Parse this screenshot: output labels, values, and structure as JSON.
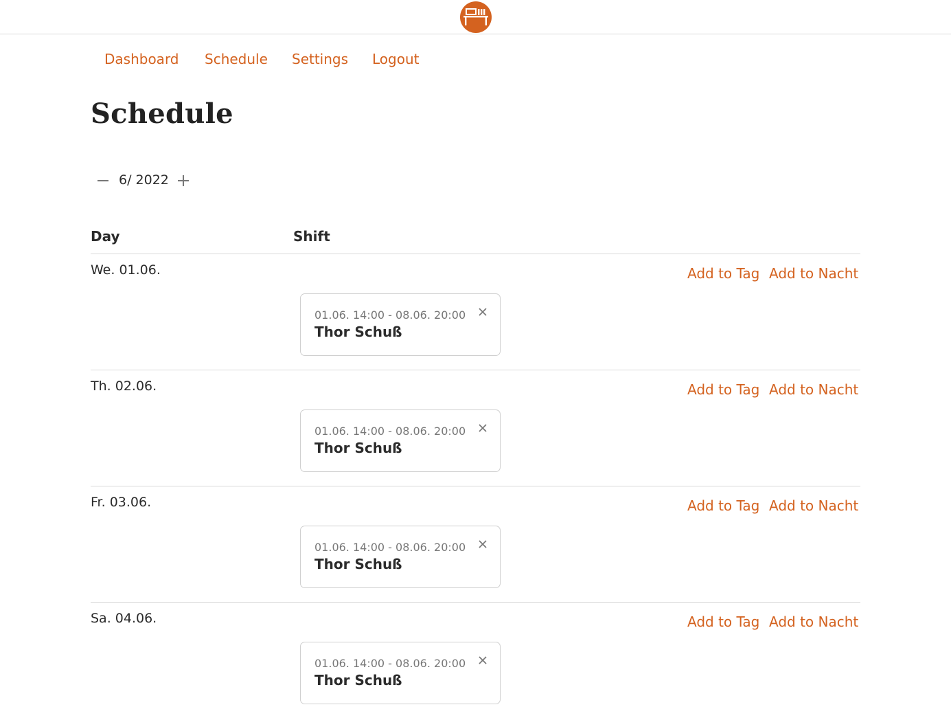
{
  "header": {
    "logo_icon": "desk-logo-icon",
    "brand_color": "#d4621f"
  },
  "nav": [
    {
      "label": "Dashboard"
    },
    {
      "label": "Schedule"
    },
    {
      "label": "Settings"
    },
    {
      "label": "Logout"
    }
  ],
  "page": {
    "title": "Schedule"
  },
  "month_nav": {
    "decrement_icon": "minus-icon",
    "value": "6/ 2022",
    "increment_icon": "plus-icon"
  },
  "table": {
    "headers": {
      "day": "Day",
      "shift": "Shift"
    },
    "rows": [
      {
        "day": "We. 01.06.",
        "add_tag": "Add to Tag",
        "add_nacht": "Add to Nacht",
        "shift": {
          "time": "01.06. 14:00 - 08.06. 20:00",
          "name": "Thor Schuß"
        }
      },
      {
        "day": "Th. 02.06.",
        "add_tag": "Add to Tag",
        "add_nacht": "Add to Nacht",
        "shift": {
          "time": "01.06. 14:00 - 08.06. 20:00",
          "name": "Thor Schuß"
        }
      },
      {
        "day": "Fr. 03.06.",
        "add_tag": "Add to Tag",
        "add_nacht": "Add to Nacht",
        "shift": {
          "time": "01.06. 14:00 - 08.06. 20:00",
          "name": "Thor Schuß"
        }
      },
      {
        "day": "Sa. 04.06.",
        "add_tag": "Add to Tag",
        "add_nacht": "Add to Nacht",
        "shift": {
          "time": "01.06. 14:00 - 08.06. 20:00",
          "name": "Thor Schuß"
        }
      }
    ]
  }
}
